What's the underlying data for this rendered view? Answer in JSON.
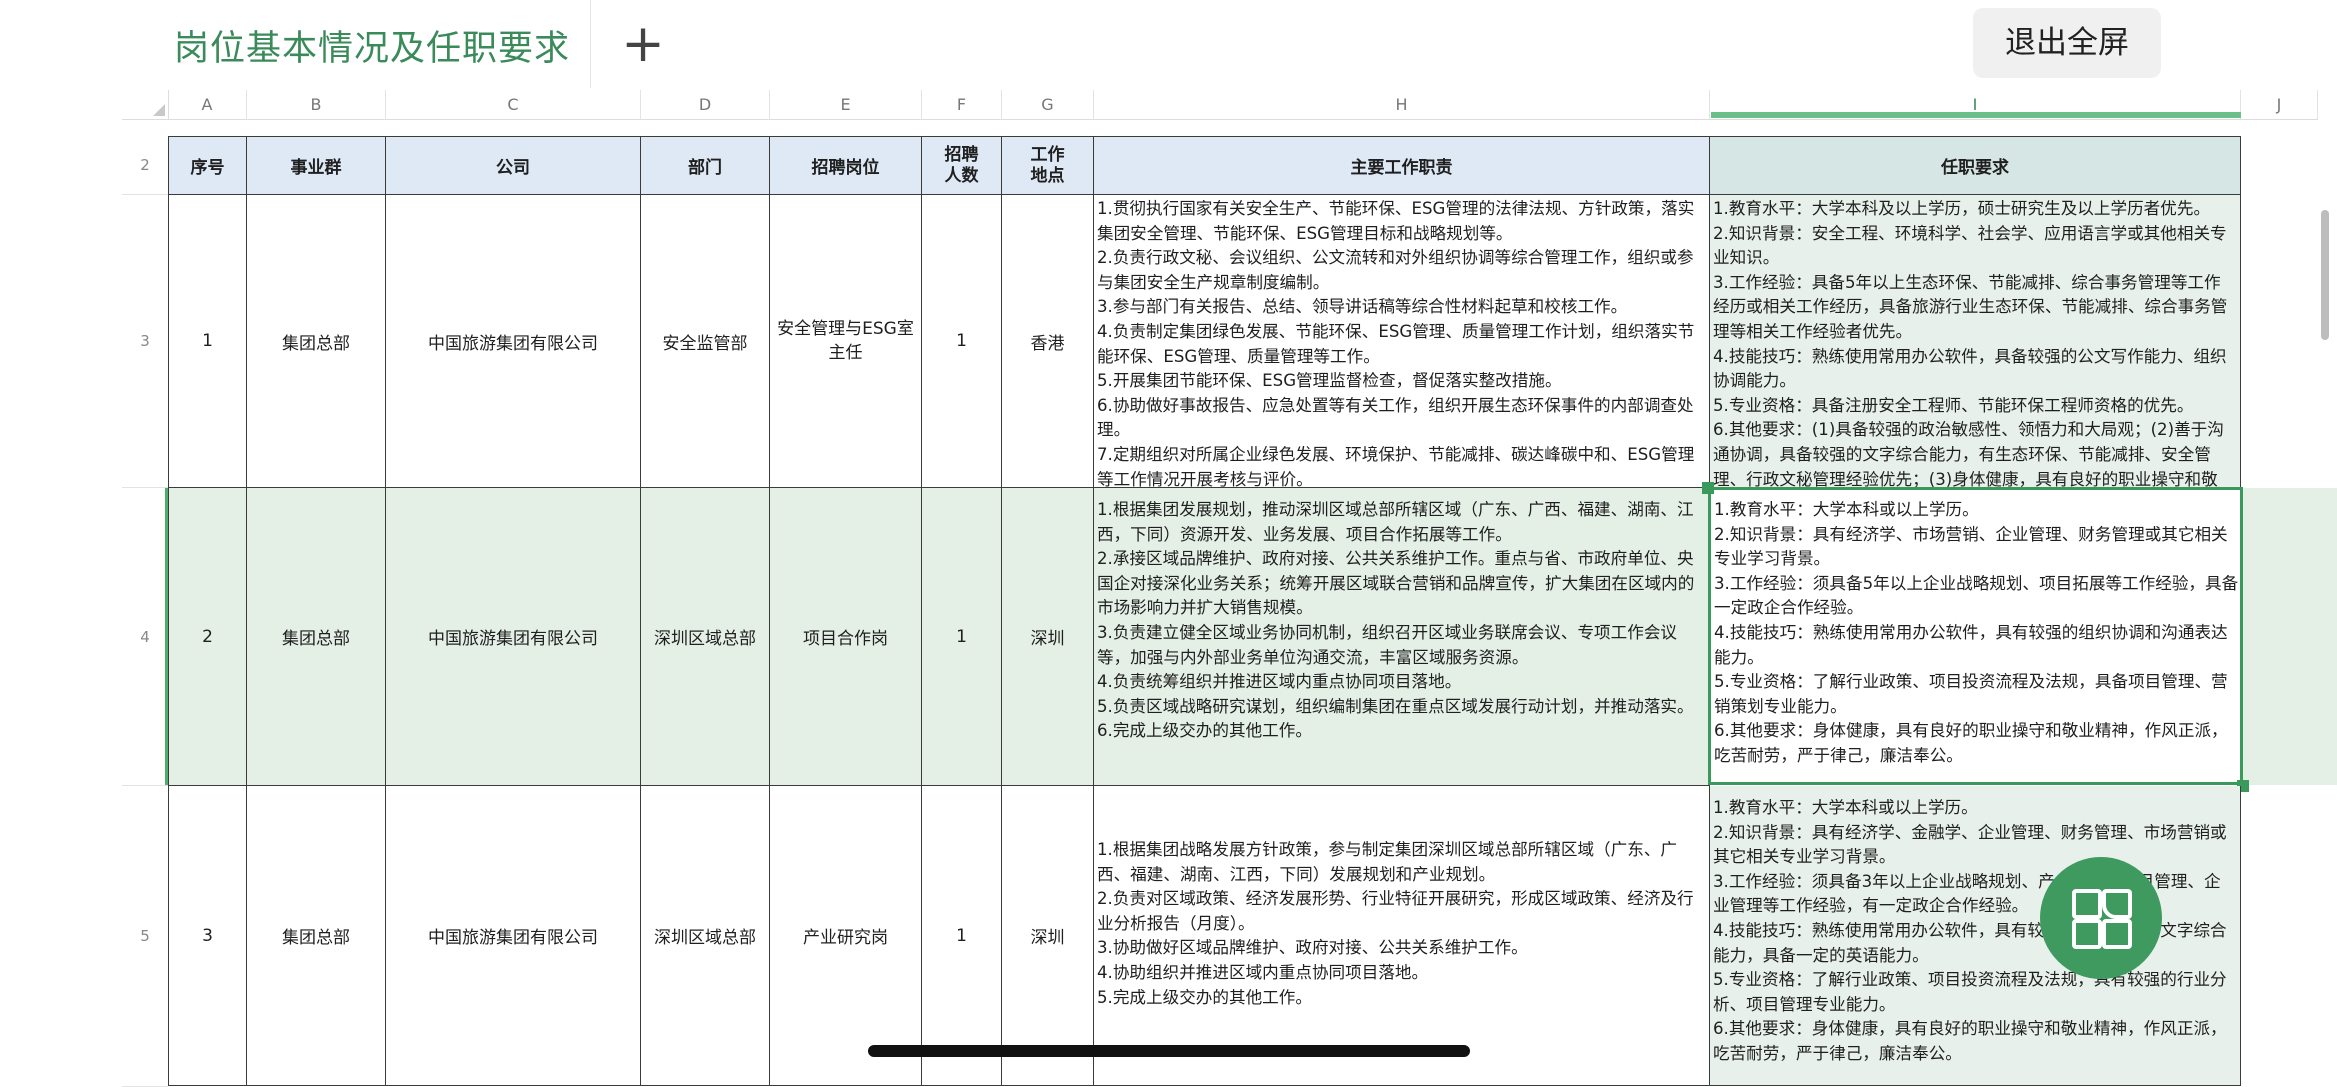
{
  "tab": {
    "title": "岗位基本情况及任职要求",
    "add": "+"
  },
  "exit_button": "退出全屏",
  "columns": [
    "A",
    "B",
    "C",
    "D",
    "E",
    "F",
    "G",
    "H",
    "I",
    "J"
  ],
  "row_numbers": [
    "2",
    "3",
    "4",
    "5"
  ],
  "header": {
    "seq": "序号",
    "group": "事业群",
    "company": "公司",
    "dept": "部门",
    "position": "招聘岗位",
    "count": "招聘\n人数",
    "location": "工作\n地点",
    "duties": "主要工作职责",
    "requirements": "任职要求"
  },
  "rows": [
    {
      "seq": "1",
      "group": "集团总部",
      "company": "中国旅游集团有限公司",
      "dept": "安全监管部",
      "position": "安全管理与ESG室\n主任",
      "count": "1",
      "location": "香港",
      "duties": "1.贯彻执行国家有关安全生产、节能环保、ESG管理的法律法规、方针政策，落实集团安全管理、节能环保、ESG管理目标和战略规划等。\n2.负责行政文秘、会议组织、公文流转和对外组织协调等综合管理工作，组织或参与集团安全生产规章制度编制。\n3.参与部门有关报告、总结、领导讲话稿等综合性材料起草和校核工作。\n4.负责制定集团绿色发展、节能环保、ESG管理、质量管理工作计划，组织落实节能环保、ESG管理、质量管理等工作。\n5.开展集团节能环保、ESG管理监督检查，督促落实整改措施。\n6.协助做好事故报告、应急处置等有关工作，组织开展生态环保事件的内部调查处理。\n7.定期组织对所属企业绿色发展、环境保护、节能减排、碳达峰碳中和、ESG管理等工作情况开展考核与评价。",
      "requirements": "1.教育水平：大学本科及以上学历，硕士研究生及以上学历者优先。\n2.知识背景：安全工程、环境科学、社会学、应用语言学或其他相关专业知识。\n3.工作经验：具备5年以上生态环保、节能减排、综合事务管理等工作经历或相关工作经历，具备旅游行业生态环保、节能减排、综合事务管理等相关工作经验者优先。\n4.技能技巧：熟练使用常用办公软件，具备较强的公文写作能力、组织协调能力。\n5.专业资格：具备注册安全工程师、节能环保工程师资格的优先。\n6.其他要求：(1)具备较强的政治敏感性、领悟力和大局观；(2)善于沟通协调，具备较强的文字综合能力，有生态环保、节能减排、安全管理、行政文秘管理经验优先；(3)身体健康，具有良好的职业操守和敬"
    },
    {
      "seq": "2",
      "group": "集团总部",
      "company": "中国旅游集团有限公司",
      "dept": "深圳区域总部",
      "position": "项目合作岗",
      "count": "1",
      "location": "深圳",
      "duties": "1.根据集团发展规划，推动深圳区域总部所辖区域（广东、广西、福建、湖南、江西，下同）资源开发、业务发展、项目合作拓展等工作。\n2.承接区域品牌维护、政府对接、公共关系维护工作。重点与省、市政府单位、央国企对接深化业务关系；统筹开展区域联合营销和品牌宣传，扩大集团在区域内的市场影响力并扩大销售规模。\n3.负责建立健全区域业务协同机制，组织召开区域业务联席会议、专项工作会议等，加强与内外部业务单位沟通交流，丰富区域服务资源。\n4.负责统筹组织并推进区域内重点协同项目落地。\n5.负责区域战略研究谋划，组织编制集团在重点区域发展行动计划，并推动落实。\n6.完成上级交办的其他工作。",
      "requirements": "1.教育水平：大学本科或以上学历。\n2.知识背景：具有经济学、市场营销、企业管理、财务管理或其它相关专业学习背景。\n3.工作经验：须具备5年以上企业战略规划、项目拓展等工作经验，具备一定政企合作经验。\n4.技能技巧：熟练使用常用办公软件，具有较强的组织协调和沟通表达能力。\n5.专业资格：了解行业政策、项目投资流程及法规，具备项目管理、营销策划专业能力。\n6.其他要求：身体健康，具有良好的职业操守和敬业精神，作风正派，吃苦耐劳，严于律己，廉洁奉公。"
    },
    {
      "seq": "3",
      "group": "集团总部",
      "company": "中国旅游集团有限公司",
      "dept": "深圳区域总部",
      "position": "产业研究岗",
      "count": "1",
      "location": "深圳",
      "duties": "1.根据集团战略发展方针政策，参与制定集团深圳区域总部所辖区域（广东、广西、福建、湖南、江西，下同）发展规划和产业规划。\n2.负责对区域政策、经济发展形势、行业特征开展研究，形成区域政策、经济及行业分析报告（月度）。\n3.协助做好区域品牌维护、政府对接、公共关系维护工作。\n4.协助组织并推进区域内重点协同项目落地。\n5.完成上级交办的其他工作。",
      "requirements": "1.教育水平：大学本科或以上学历。\n2.知识背景：具有经济学、金融学、企业管理、财务管理、市场营销或其它相关专业学习背景。\n3.工作经验：须具备3年以上企业战略规划、产业研究、项目管理、企业管理等工作经验，有一定政企合作经验。\n4.技能技巧：熟练使用常用办公软件，具有较强的组织协调和文字综合能力，具备一定的英语能力。\n5.专业资格：了解行业政策、项目投资流程及法规，具有较强的行业分析、项目管理专业能力。\n6.其他要求：身体健康，具有良好的职业操守和敬业精神，作风正派，吃苦耐劳，严于律己，廉洁奉公。"
    }
  ],
  "icons": {
    "fab": "apps-grid-icon",
    "add": "plus-icon"
  },
  "colors": {
    "accent": "#3a8a5a",
    "header_fill": "#dfe9f5",
    "selection": "#e4efe6"
  }
}
